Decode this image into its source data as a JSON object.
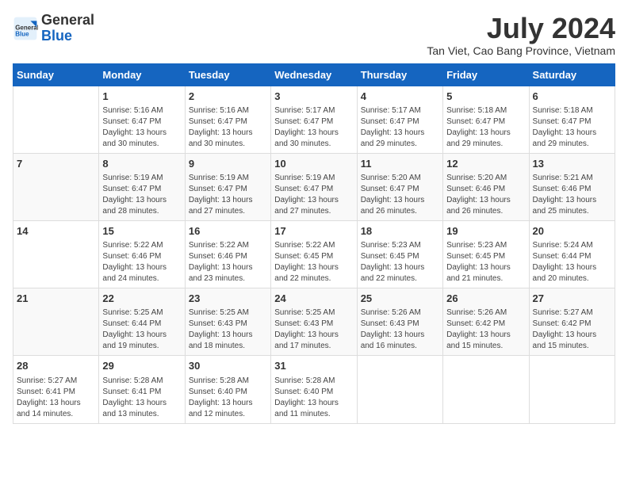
{
  "header": {
    "logo_general": "General",
    "logo_blue": "Blue",
    "month_title": "July 2024",
    "subtitle": "Tan Viet, Cao Bang Province, Vietnam"
  },
  "calendar": {
    "days_of_week": [
      "Sunday",
      "Monday",
      "Tuesday",
      "Wednesday",
      "Thursday",
      "Friday",
      "Saturday"
    ],
    "weeks": [
      [
        {
          "day": "",
          "detail": ""
        },
        {
          "day": "1",
          "detail": "Sunrise: 5:16 AM\nSunset: 6:47 PM\nDaylight: 13 hours\nand 30 minutes."
        },
        {
          "day": "2",
          "detail": "Sunrise: 5:16 AM\nSunset: 6:47 PM\nDaylight: 13 hours\nand 30 minutes."
        },
        {
          "day": "3",
          "detail": "Sunrise: 5:17 AM\nSunset: 6:47 PM\nDaylight: 13 hours\nand 30 minutes."
        },
        {
          "day": "4",
          "detail": "Sunrise: 5:17 AM\nSunset: 6:47 PM\nDaylight: 13 hours\nand 29 minutes."
        },
        {
          "day": "5",
          "detail": "Sunrise: 5:18 AM\nSunset: 6:47 PM\nDaylight: 13 hours\nand 29 minutes."
        },
        {
          "day": "6",
          "detail": "Sunrise: 5:18 AM\nSunset: 6:47 PM\nDaylight: 13 hours\nand 29 minutes."
        }
      ],
      [
        {
          "day": "7",
          "detail": ""
        },
        {
          "day": "8",
          "detail": "Sunrise: 5:19 AM\nSunset: 6:47 PM\nDaylight: 13 hours\nand 28 minutes."
        },
        {
          "day": "9",
          "detail": "Sunrise: 5:19 AM\nSunset: 6:47 PM\nDaylight: 13 hours\nand 27 minutes."
        },
        {
          "day": "10",
          "detail": "Sunrise: 5:19 AM\nSunset: 6:47 PM\nDaylight: 13 hours\nand 27 minutes."
        },
        {
          "day": "11",
          "detail": "Sunrise: 5:20 AM\nSunset: 6:47 PM\nDaylight: 13 hours\nand 26 minutes."
        },
        {
          "day": "12",
          "detail": "Sunrise: 5:20 AM\nSunset: 6:46 PM\nDaylight: 13 hours\nand 26 minutes."
        },
        {
          "day": "13",
          "detail": "Sunrise: 5:21 AM\nSunset: 6:46 PM\nDaylight: 13 hours\nand 25 minutes."
        }
      ],
      [
        {
          "day": "14",
          "detail": ""
        },
        {
          "day": "15",
          "detail": "Sunrise: 5:22 AM\nSunset: 6:46 PM\nDaylight: 13 hours\nand 24 minutes."
        },
        {
          "day": "16",
          "detail": "Sunrise: 5:22 AM\nSunset: 6:46 PM\nDaylight: 13 hours\nand 23 minutes."
        },
        {
          "day": "17",
          "detail": "Sunrise: 5:22 AM\nSunset: 6:45 PM\nDaylight: 13 hours\nand 22 minutes."
        },
        {
          "day": "18",
          "detail": "Sunrise: 5:23 AM\nSunset: 6:45 PM\nDaylight: 13 hours\nand 22 minutes."
        },
        {
          "day": "19",
          "detail": "Sunrise: 5:23 AM\nSunset: 6:45 PM\nDaylight: 13 hours\nand 21 minutes."
        },
        {
          "day": "20",
          "detail": "Sunrise: 5:24 AM\nSunset: 6:44 PM\nDaylight: 13 hours\nand 20 minutes."
        }
      ],
      [
        {
          "day": "21",
          "detail": ""
        },
        {
          "day": "22",
          "detail": "Sunrise: 5:25 AM\nSunset: 6:44 PM\nDaylight: 13 hours\nand 19 minutes."
        },
        {
          "day": "23",
          "detail": "Sunrise: 5:25 AM\nSunset: 6:43 PM\nDaylight: 13 hours\nand 18 minutes."
        },
        {
          "day": "24",
          "detail": "Sunrise: 5:25 AM\nSunset: 6:43 PM\nDaylight: 13 hours\nand 17 minutes."
        },
        {
          "day": "25",
          "detail": "Sunrise: 5:26 AM\nSunset: 6:43 PM\nDaylight: 13 hours\nand 16 minutes."
        },
        {
          "day": "26",
          "detail": "Sunrise: 5:26 AM\nSunset: 6:42 PM\nDaylight: 13 hours\nand 15 minutes."
        },
        {
          "day": "27",
          "detail": "Sunrise: 5:27 AM\nSunset: 6:42 PM\nDaylight: 13 hours\nand 15 minutes."
        }
      ],
      [
        {
          "day": "28",
          "detail": "Sunrise: 5:27 AM\nSunset: 6:41 PM\nDaylight: 13 hours\nand 14 minutes."
        },
        {
          "day": "29",
          "detail": "Sunrise: 5:28 AM\nSunset: 6:41 PM\nDaylight: 13 hours\nand 13 minutes."
        },
        {
          "day": "30",
          "detail": "Sunrise: 5:28 AM\nSunset: 6:40 PM\nDaylight: 13 hours\nand 12 minutes."
        },
        {
          "day": "31",
          "detail": "Sunrise: 5:28 AM\nSunset: 6:40 PM\nDaylight: 13 hours\nand 11 minutes."
        },
        {
          "day": "",
          "detail": ""
        },
        {
          "day": "",
          "detail": ""
        },
        {
          "day": "",
          "detail": ""
        }
      ]
    ]
  }
}
